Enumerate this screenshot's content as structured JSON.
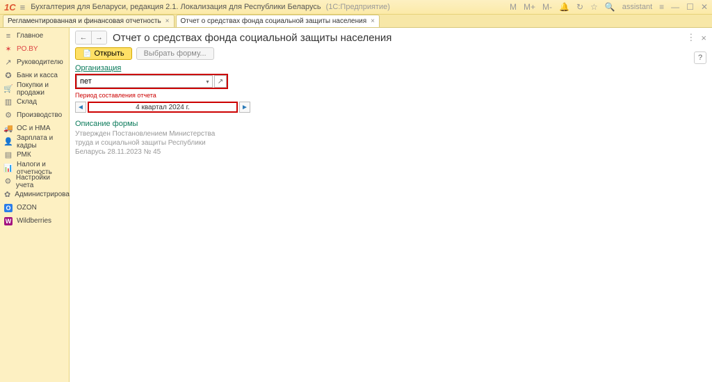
{
  "titlebar": {
    "app_title": "Бухгалтерия для Беларуси, редакция 2.1. Локализация для Республики Беларусь",
    "app_suffix": "(1С:Предприятие)",
    "user_label": "assistant",
    "m_labels": [
      "M",
      "M+",
      "M-"
    ]
  },
  "tabs": [
    {
      "label": "Регламентированная и финансовая отчетность"
    },
    {
      "label": "Отчет о средствах фонда социальной защиты населения"
    }
  ],
  "sidebar": [
    {
      "icon": "≡",
      "label": "Главное"
    },
    {
      "icon": "✶",
      "label": "PO.BY",
      "color": "#d44"
    },
    {
      "icon": "↗",
      "label": "Руководителю"
    },
    {
      "icon": "✪",
      "label": "Банк и касса"
    },
    {
      "icon": "🛒",
      "label": "Покупки и продажи"
    },
    {
      "icon": "▥",
      "label": "Склад"
    },
    {
      "icon": "⚙",
      "label": "Производство"
    },
    {
      "icon": "🚚",
      "label": "ОС и НМА"
    },
    {
      "icon": "👤",
      "label": "Зарплата и кадры"
    },
    {
      "icon": "▤",
      "label": "РМК"
    },
    {
      "icon": "📊",
      "label": "Налоги и отчетность"
    },
    {
      "icon": "⚙",
      "label": "Настройки учета"
    },
    {
      "icon": "✿",
      "label": "Администрирование"
    },
    {
      "icon": "O",
      "label": "OZON",
      "bg": "#2b7de9"
    },
    {
      "icon": "W",
      "label": "Wildberries",
      "bg": "#a3127f"
    }
  ],
  "page": {
    "title": "Отчет о средствах фонда социальной защиты населения",
    "open_btn": "Открыть",
    "select_btn": "Выбрать форму...",
    "org_label": "Организация",
    "org_value": "пет",
    "period_label": "Период составления отчета",
    "period_value": "4 квартал 2024 г.",
    "desc_head": "Описание формы",
    "desc_body": "Утвержден Постановлением Министерства труда и социальной защиты Республики Беларусь 28.11.2023 № 45"
  }
}
